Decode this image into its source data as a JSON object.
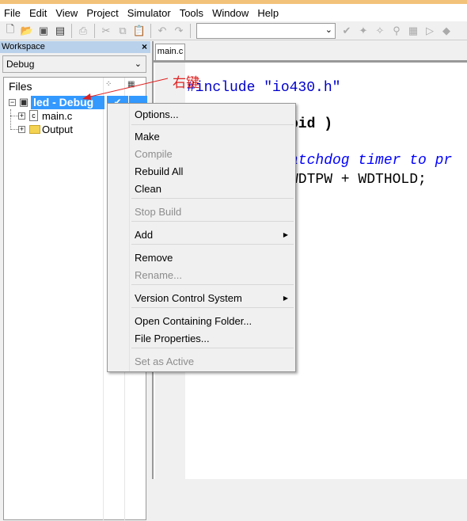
{
  "menubar": [
    "File",
    "Edit",
    "View",
    "Project",
    "Simulator",
    "Tools",
    "Window",
    "Help"
  ],
  "toolbar": {
    "icons": [
      "new-file-icon",
      "open-folder-icon",
      "save-icon",
      "save-all-icon",
      "print-icon",
      "cut-icon",
      "copy-icon",
      "paste-icon",
      "undo-icon",
      "redo-icon"
    ],
    "combo_value": ""
  },
  "workspace": {
    "title": "Workspace",
    "config": "Debug",
    "files_header": "Files",
    "project": "led - Debug",
    "project_check": "✔",
    "items": [
      "main.c",
      "Output"
    ]
  },
  "editor": {
    "tab": "main.c",
    "lines": [
      "#include \"io430.h\"",
      "oid )",
      "atchdog timer to pr",
      "WDTPW + WDTHOLD;"
    ]
  },
  "annotation": "右键",
  "context_menu": {
    "items": [
      {
        "label": "Options...",
        "enabled": true
      },
      {
        "label": "Make",
        "enabled": true
      },
      {
        "label": "Compile",
        "enabled": false
      },
      {
        "label": "Rebuild All",
        "enabled": true
      },
      {
        "label": "Clean",
        "enabled": true
      },
      {
        "label": "Stop Build",
        "enabled": false
      },
      {
        "label": "Add",
        "enabled": true,
        "submenu": true
      },
      {
        "label": "Remove",
        "enabled": true
      },
      {
        "label": "Rename...",
        "enabled": false
      },
      {
        "label": "Version Control System",
        "enabled": true,
        "submenu": true
      },
      {
        "label": "Open Containing Folder...",
        "enabled": true
      },
      {
        "label": "File Properties...",
        "enabled": true
      },
      {
        "label": "Set as Active",
        "enabled": false
      }
    ]
  },
  "colors": {
    "selection": "#3399ff",
    "keyword_blue": "#0000cc",
    "comment_blue": "#0000ff",
    "annotation_red": "#e02020"
  }
}
